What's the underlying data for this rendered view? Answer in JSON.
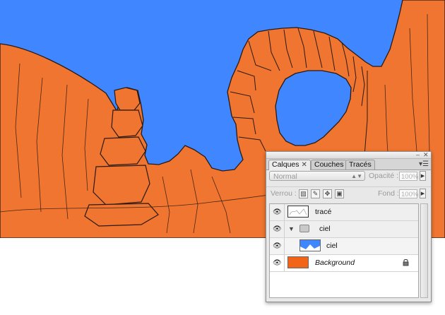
{
  "canvas": {
    "sky_color": "#3f86ff",
    "rock_color": "#f07530",
    "line_color": "#2a1a10"
  },
  "panel": {
    "tabs": [
      {
        "label": "Calques",
        "active": true
      },
      {
        "label": "Couches",
        "active": false
      },
      {
        "label": "Tracés",
        "active": false
      }
    ],
    "close_glyph": "✕",
    "blend_mode": "Normal",
    "opacity_label": "Opacité :",
    "opacity_value": "100%",
    "lock_label": "Verrou :",
    "fill_label": "Fond :",
    "fill_value": "100%",
    "lock_icons": [
      "lock-transparent-icon",
      "lock-brush-icon",
      "lock-move-icon",
      "lock-all-icon"
    ],
    "layers": [
      {
        "name": "tracé",
        "type": "layer",
        "visible": true
      },
      {
        "name": "ciel",
        "type": "group",
        "visible": true,
        "expanded": true
      },
      {
        "name": "ciel",
        "type": "layer",
        "visible": true,
        "indented": true
      },
      {
        "name": "Background",
        "type": "background",
        "visible": true,
        "locked": true,
        "color": "#f26418"
      }
    ]
  }
}
